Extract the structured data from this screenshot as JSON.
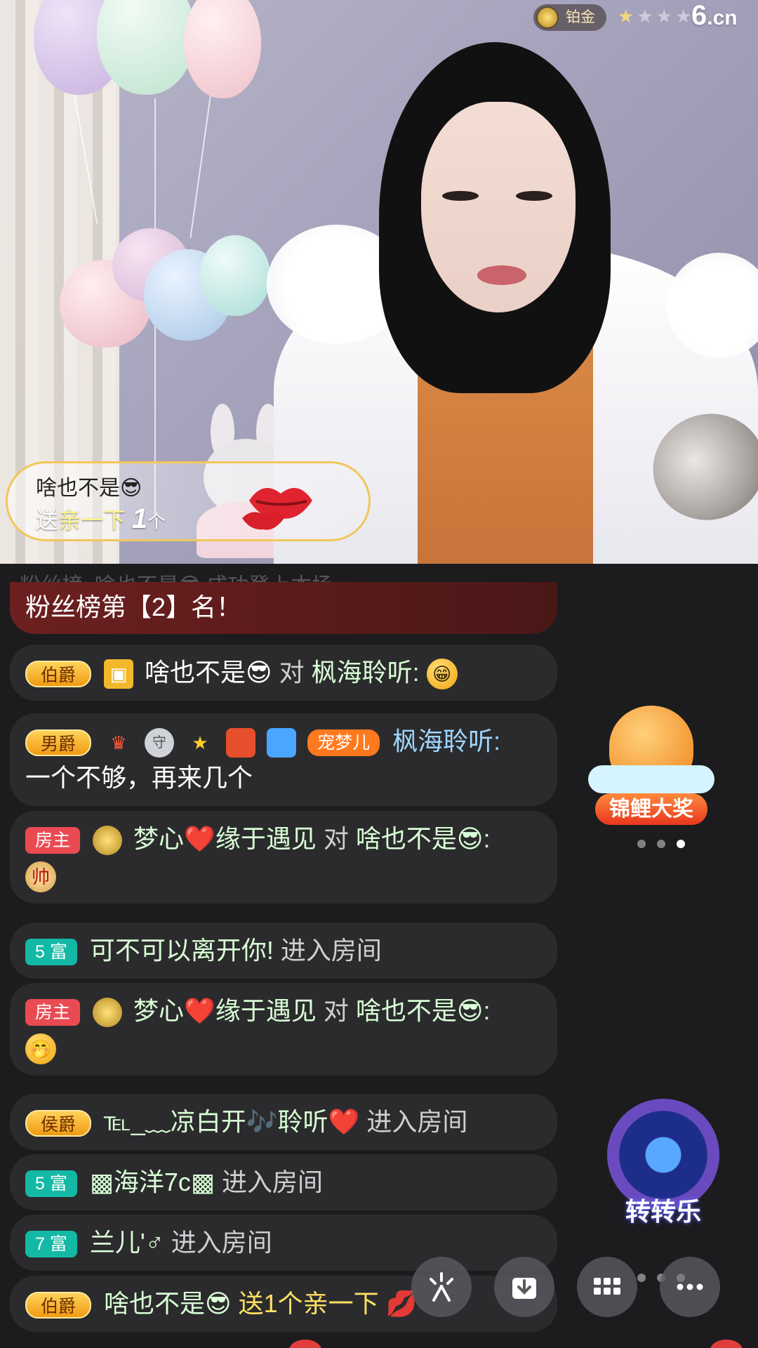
{
  "header": {
    "badge_label": "铂金",
    "logo_text": "6",
    "logo_suffix": ".cn",
    "stars": [
      "★",
      "★",
      "★",
      "★"
    ]
  },
  "gift_banner": {
    "sender": "啥也不是😎",
    "prefix": "送",
    "gift_name": "亲一下",
    "count": "1",
    "unit": "个"
  },
  "chat": {
    "ghost_line": "粉丝榜: 啥也不是😎 成功登上本场",
    "rank_text": "粉丝榜第【2】名！",
    "messages": [
      {
        "tag": "伯爵",
        "user": "啥也不是😎",
        "to_word": "对",
        "target": "枫海聆听:",
        "emoji": "😁"
      },
      {
        "tag": "男爵",
        "pet_tag": "宠梦儿",
        "user": "枫海聆听:",
        "text": "一个不够，再来几个"
      },
      {
        "tag": "房主",
        "user": "梦心❤️缘于遇见",
        "to_word": "对",
        "target": "啥也不是😎:",
        "emoji": "帅"
      },
      {
        "tag": "5 富",
        "user": "可不可以离开你!",
        "action": "进入房间"
      },
      {
        "tag": "房主",
        "user": "梦心❤️缘于遇见",
        "to_word": "对",
        "target": "啥也不是😎:",
        "emoji": "🤭"
      },
      {
        "tag": "侯爵",
        "user": "℡_﹏凉白开🎶聆听❤️",
        "action": "进入房间"
      },
      {
        "tag": "5 富",
        "user": "▩海洋7c▩",
        "action": "进入房间"
      },
      {
        "tag": "7 富",
        "user": "兰儿'♂",
        "action": "进入房间"
      },
      {
        "tag": "伯爵",
        "user": "啥也不是😎",
        "text": "送1个亲一下"
      }
    ]
  },
  "widgets": {
    "koi_label": "锦鲤大奖",
    "wheel_label": "转转乐"
  },
  "colors": {
    "chat_bg": "#1c1c1e",
    "bubble": "#2b2b2d",
    "noble": "#f0a51a",
    "host": "#ea4b53",
    "rich": "#13b9a5"
  }
}
